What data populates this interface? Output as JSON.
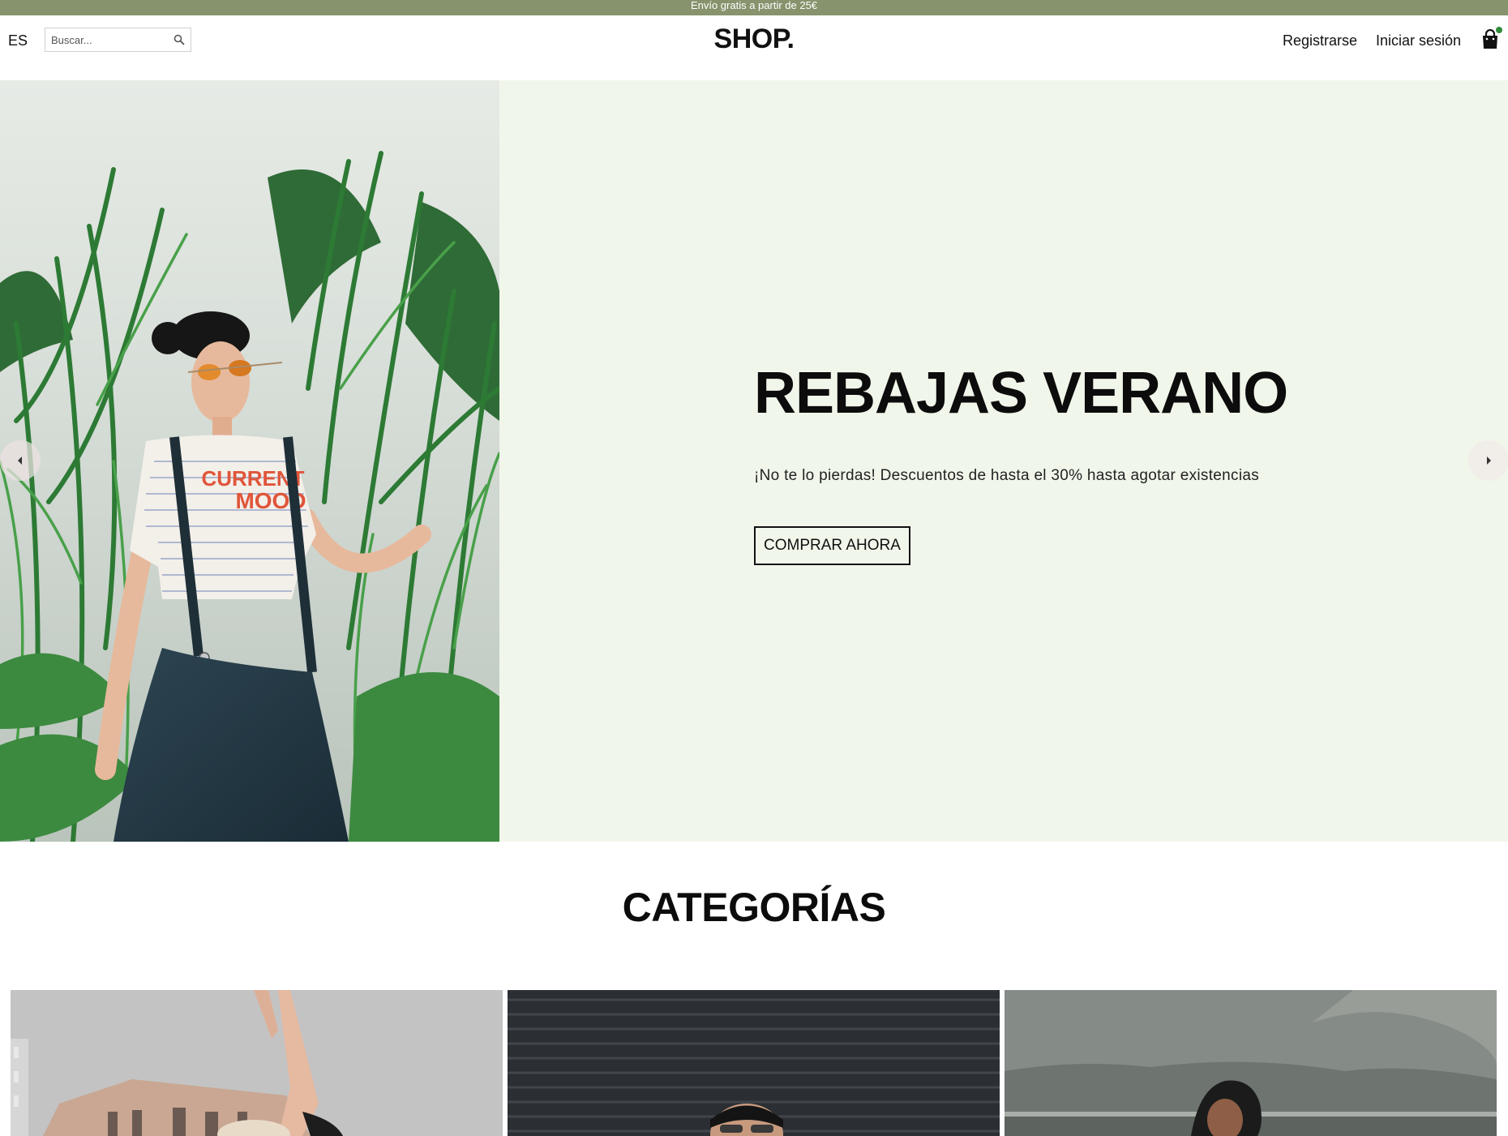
{
  "announcement": {
    "text": "Envío gratis a partir de 25€"
  },
  "header": {
    "language": "ES",
    "search": {
      "placeholder": "Buscar...",
      "value": ""
    },
    "logo": "SHOP.",
    "nav": {
      "register": "Registrarse",
      "login": "Iniciar sesión"
    },
    "icons": {
      "search": "search-icon",
      "cart": "shopping-bag-icon"
    }
  },
  "hero": {
    "title": "REBAJAS VERANO",
    "subtitle": "¡No te lo pierdas! Descuentos de hasta el 30% hasta agotar existencias",
    "cta": "COMPRAR AHORA",
    "shirt_print": [
      "CURRENT",
      "MOOD"
    ],
    "icons": {
      "prev": "chevron-left-icon",
      "next": "chevron-right-icon"
    }
  },
  "categories": {
    "title": "CATEGORÍAS"
  },
  "colors": {
    "announcement_bg": "#86936c",
    "hero_bg": "#f1f6ea",
    "cart_badge": "#2e8b3a",
    "text": "#111111"
  }
}
